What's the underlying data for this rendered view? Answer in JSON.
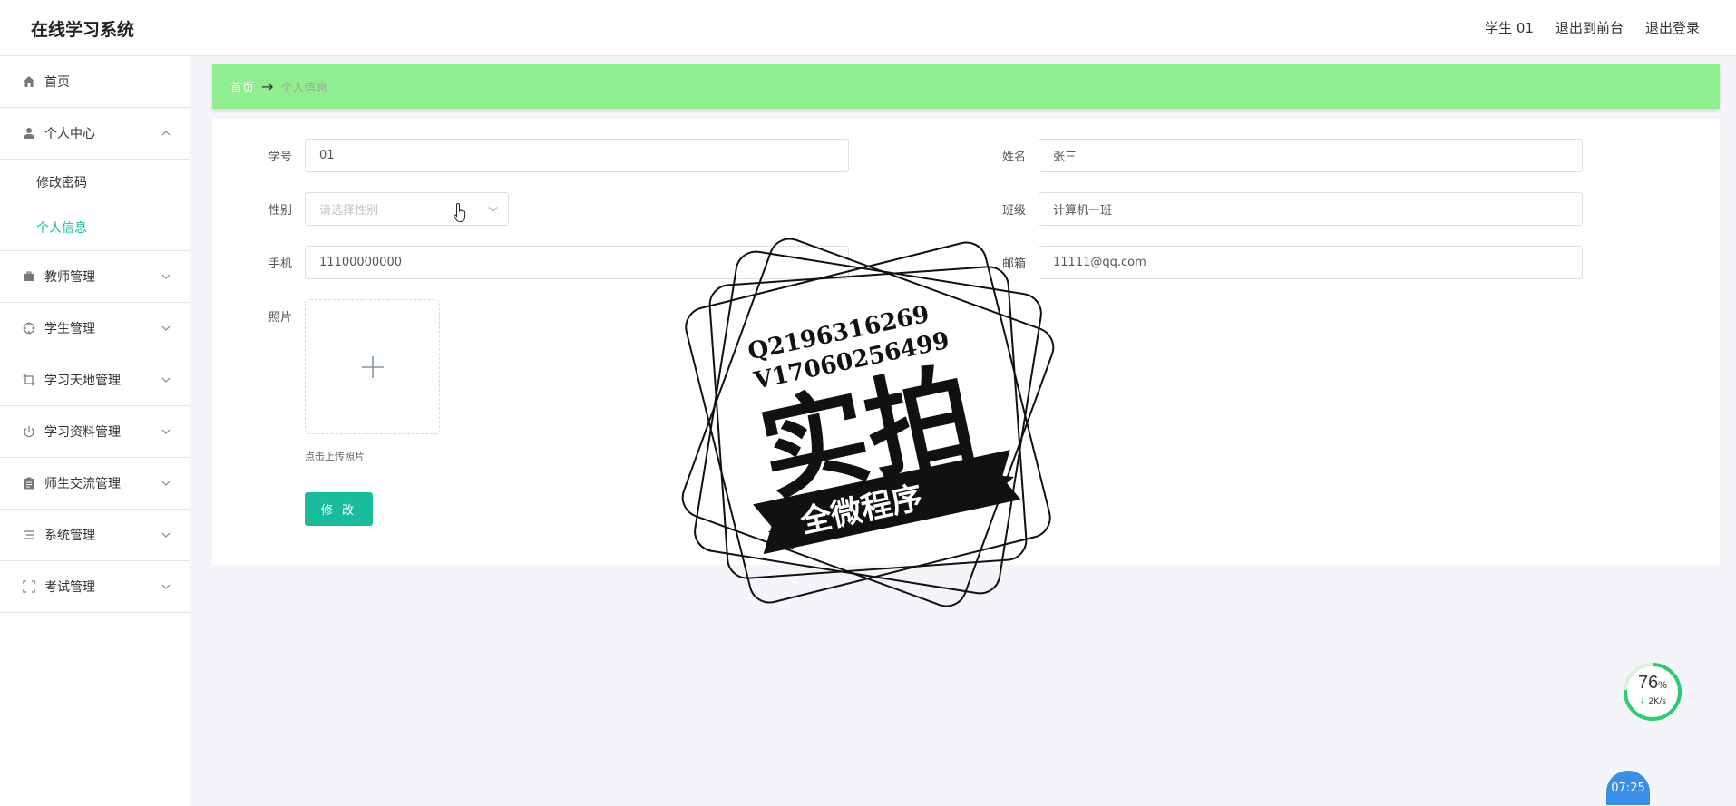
{
  "header": {
    "app_title": "在线学习系统",
    "user_name": "学生 01",
    "back_to_front": "退出到前台",
    "logout": "退出登录"
  },
  "sidebar": {
    "items": [
      {
        "label": "首页",
        "icon": "home-icon"
      },
      {
        "label": "个人中心",
        "icon": "user-icon",
        "expanded": true,
        "children": [
          {
            "label": "修改密码",
            "active": false
          },
          {
            "label": "个人信息",
            "active": true
          }
        ]
      },
      {
        "label": "教师管理",
        "icon": "briefcase-icon"
      },
      {
        "label": "学生管理",
        "icon": "crosshair-icon"
      },
      {
        "label": "学习天地管理",
        "icon": "crop-icon"
      },
      {
        "label": "学习资料管理",
        "icon": "power-icon"
      },
      {
        "label": "师生交流管理",
        "icon": "clipboard-icon"
      },
      {
        "label": "系统管理",
        "icon": "list-icon"
      },
      {
        "label": "考试管理",
        "icon": "scan-icon"
      }
    ]
  },
  "breadcrumb": {
    "home": "首页",
    "arrow": "→",
    "current": "个人信息"
  },
  "form": {
    "student_no_label": "学号",
    "student_no_value": "01",
    "name_label": "姓名",
    "name_value": "张三",
    "gender_label": "性别",
    "gender_placeholder": "请选择性别",
    "class_label": "班级",
    "class_value": "计算机一班",
    "phone_label": "手机",
    "phone_value": "11100000000",
    "email_label": "邮箱",
    "email_value": "11111@qq.com",
    "photo_label": "照片",
    "upload_tip": "点击上传照片",
    "submit_label": "修 改"
  },
  "watermark": {
    "line1": "Q2196316269",
    "line2": "V17060256499",
    "main_text": "实拍",
    "ribbon_text": "全微程序"
  },
  "widgets": {
    "net_percent": "76",
    "percent_sign": "%",
    "net_speed": "2K/s",
    "clock": "07:25"
  },
  "colors": {
    "accent": "#1abc9c",
    "breadcrumb_bg": "#90ee90",
    "widget_ring": "#2ecc71",
    "clock_bg": "#3a8ee6"
  }
}
